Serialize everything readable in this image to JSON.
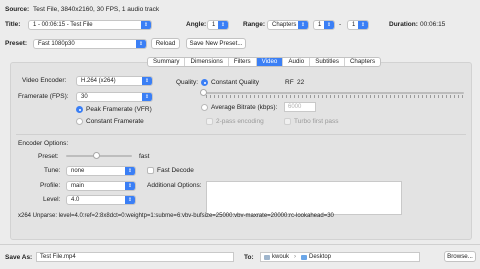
{
  "source": {
    "label": "Source:",
    "value": "Test File, 3840x2160, 30 FPS, 1 audio track"
  },
  "title_row": {
    "label": "Title:",
    "title_value": "1 - 00:06:15 - Test File",
    "angle_label": "Angle:",
    "angle_value": "1",
    "range_label": "Range:",
    "range_type": "Chapters",
    "range_from": "1",
    "range_to": "1",
    "duration_label": "Duration:",
    "duration_value": "00:06:15"
  },
  "preset_row": {
    "label": "Preset:",
    "value": "Fast 1080p30",
    "reload": "Reload",
    "save_new": "Save New Preset..."
  },
  "tabs": [
    "Summary",
    "Dimensions",
    "Filters",
    "Video",
    "Audio",
    "Subtitles",
    "Chapters"
  ],
  "active_tab": "Video",
  "video": {
    "encoder_label": "Video Encoder:",
    "encoder_value": "H.264 (x264)",
    "framerate_label": "Framerate (FPS):",
    "framerate_value": "30",
    "peak_label": "Peak Framerate (VFR)",
    "constant_label": "Constant Framerate",
    "quality_label": "Quality:",
    "cq_label": "Constant Quality",
    "rf_label": "RF",
    "rf_value": "22",
    "abr_label": "Average Bitrate (kbps):",
    "abr_value": "6000",
    "twopass_label": "2-pass encoding",
    "turbo_label": "Turbo first pass"
  },
  "encoder_options": {
    "heading": "Encoder Options:",
    "preset_label": "Preset:",
    "preset_slider_value": "fast",
    "tune_label": "Tune:",
    "tune_value": "none",
    "fast_decode_label": "Fast Decode",
    "profile_label": "Profile:",
    "profile_value": "main",
    "additional_label": "Additional Options:",
    "level_label": "Level:",
    "level_value": "4.0"
  },
  "unparse": "x264 Unparse: level=4.0:ref=2:8x8dct=0:weightp=1:subme=6:vbv-bufsize=25000:vbv-maxrate=20000:rc-lookahead=30",
  "save": {
    "label": "Save As:",
    "value": "Test File.mp4",
    "to_label": "To:",
    "user": "kwouk",
    "folder": "Desktop",
    "browse": "Browse..."
  },
  "colors": {
    "accent": "#3b7ff5",
    "background": "#ececec"
  }
}
